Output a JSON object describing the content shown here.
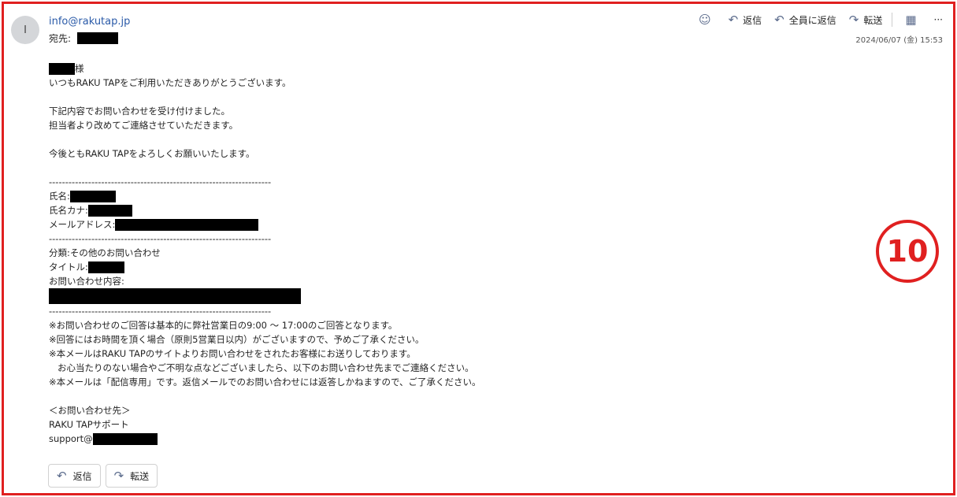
{
  "header": {
    "avatar_initial": "I",
    "sender": "info@rakutap.jp",
    "to_label": "宛先:",
    "date": "2024/06/07 (金) 15:53"
  },
  "toolbar": {
    "emoji_icon": "smile-icon",
    "reply": "返信",
    "reply_all": "全員に返信",
    "forward": "転送",
    "more": "···"
  },
  "body": {
    "salutation_suffix": "様",
    "l1": "いつもRAKU TAPをご利用いただきありがとうございます。",
    "l2": "下記内容でお問い合わせを受け付けました。",
    "l3": "担当者より改めてご連絡させていただきます。",
    "l4": "今後ともRAKU TAPをよろしくお願いいたします。",
    "sep": "--------------------------------------------------------------------",
    "name_label": "氏名:",
    "kana_label": "氏名カナ:",
    "mail_label": "メールアドレス:",
    "cat": "分類:その他のお問い合わせ",
    "title_label": "タイトル:",
    "content_label": "お問い合わせ内容:",
    "n1": "※お問い合わせのご回答は基本的に弊社営業日の9:00 〜 17:00のご回答となります。",
    "n2": "※回答にはお時間を頂く場合（原則5営業日以内）がございますので、予めご了承ください。",
    "n3": "※本メールはRAKU TAPのサイトよりお問い合わせをされたお客様にお送りしております。",
    "n4": "   お心当たりのない場合やご不明な点などございましたら、以下のお問い合わせ先までご連絡ください。",
    "n5": "※本メールは「配信専用」です。返信メールでのお問い合わせには返答しかねますので、ご了承ください。",
    "c1": "＜お問い合わせ先＞",
    "c2": "RAKU TAPサポート",
    "c3": "support@"
  },
  "badge": "10",
  "bottom": {
    "reply": "返信",
    "forward": "転送"
  },
  "colors": {
    "frame": "#e02020",
    "link": "#2a5aa8"
  }
}
